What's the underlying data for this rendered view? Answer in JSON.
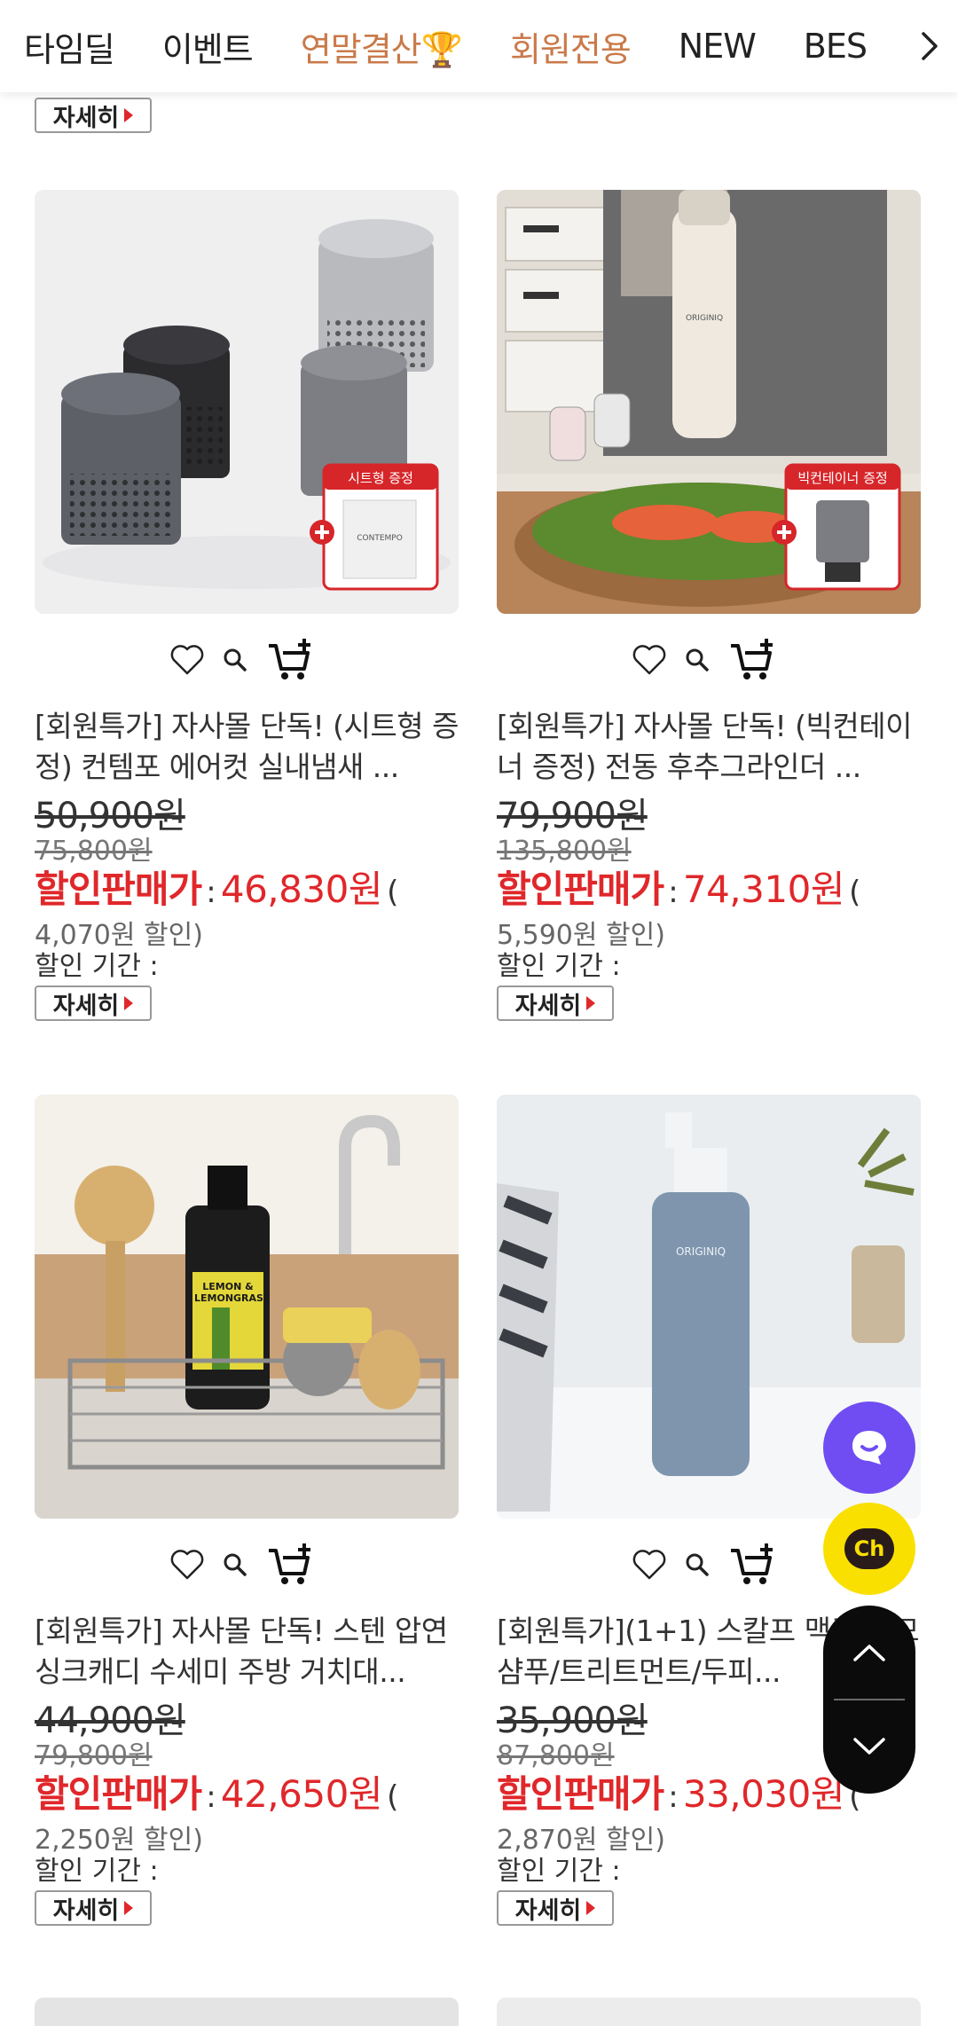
{
  "nav": {
    "tabs": [
      "타임딜",
      "이벤트",
      "연말결산🏆",
      "회원전용",
      "NEW",
      "BES"
    ],
    "orange_tabs": [
      2,
      3
    ],
    "accent_orange": "#c97a4a"
  },
  "detail_label": "자세히",
  "labels": {
    "sale_label": "할인판매가",
    "colon": ":",
    "period_label": "할인 기간 :"
  },
  "colors": {
    "sale_red": "#e0272a",
    "chat_purple": "#6f4df2",
    "kakao_yellow": "#f9e000"
  },
  "products": [
    {
      "name": "[회원특가] 자사몰 단독! (시트형 증정) 컨템포 에어컷 실내냄새 ...",
      "price": "50,900원",
      "consumer_price": "75,800원",
      "sale_price": "46,830원",
      "paren_open": "(",
      "discount": "4,070원 할인)",
      "badge": "시트형 증정",
      "image_text": "CONTEMPO"
    },
    {
      "name": "[회원특가] 자사몰 단독! (빅컨테이너 증정) 전동 후추그라인더 ...",
      "price": "79,900원",
      "consumer_price": "135,800원",
      "sale_price": "74,310원",
      "paren_open": "(",
      "discount": "5,590원 할인)",
      "badge": "빅컨테이너 증정",
      "image_text": "ORIGINIQ"
    },
    {
      "name": "[회원특가] 자사몰 단독! 스텐 압연 싱크캐디 수세미 주방 거치대...",
      "price": "44,900원",
      "consumer_price": "79,800원",
      "sale_price": "42,650원",
      "paren_open": "(",
      "discount": "2,250원 할인)",
      "image_text": "LEMON & LEMONGRASS"
    },
    {
      "name": "[회원특가](1+1) 스칼프 맥주 탈모샴푸/트리트먼트/두피...",
      "price": "35,900원",
      "consumer_price": "87,800원",
      "sale_price": "33,030원",
      "paren_open": "(",
      "discount": "2,870원 할인)",
      "image_text": "ORIGINIQ"
    }
  ],
  "float": {
    "kakao_label": "Ch"
  }
}
